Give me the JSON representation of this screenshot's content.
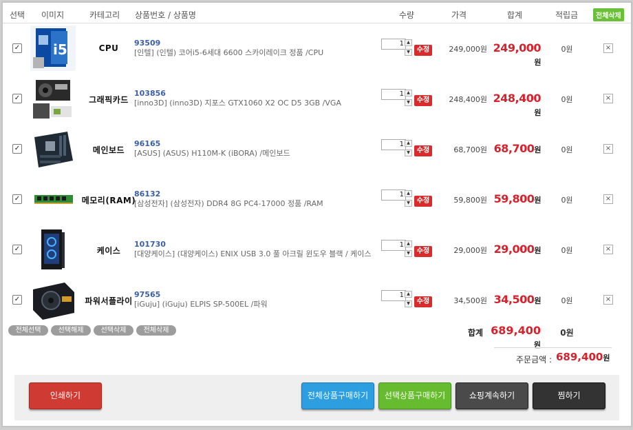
{
  "header": {
    "select": "선택",
    "image": "이미지",
    "category": "카테고리",
    "product": "상품번호 / 상품명",
    "qty": "수량",
    "price": "가격",
    "total": "합계",
    "points": "적립금",
    "delete_all": "전체삭제"
  },
  "items": [
    {
      "category": "CPU",
      "code": "93509",
      "name": "[인텔] (인텔) 코어i5-6세대 6600 스카이레이크 정품 /CPU",
      "qty": "1",
      "edit": "수정",
      "price": "249,000원",
      "total": "249,000",
      "won": "원",
      "points": "0원",
      "x": "×"
    },
    {
      "category": "그래픽카드",
      "code": "103856",
      "name": "[inno3D] (inno3D) 지포스 GTX1060 X2 OC D5 3GB /VGA",
      "qty": "1",
      "edit": "수정",
      "price": "248,400원",
      "total": "248,400",
      "won": "원",
      "points": "0원",
      "x": "×"
    },
    {
      "category": "메인보드",
      "code": "96165",
      "name": "[ASUS] (ASUS) H110M-K (iBORA) /메인보드",
      "qty": "1",
      "edit": "수정",
      "price": "68,700원",
      "total": "68,700",
      "won": "원",
      "points": "0원",
      "x": "×"
    },
    {
      "category": "메모리(RAM)",
      "code": "86132",
      "name": "[삼성전자] (삼성전자) DDR4 8G PC4-17000 정품 /RAM",
      "qty": "1",
      "edit": "수정",
      "price": "59,800원",
      "total": "59,800",
      "won": "원",
      "points": "0원",
      "x": "×"
    },
    {
      "category": "케이스",
      "code": "101730",
      "name": "[대양케이스] (대양케이스) ENIX USB 3.0 풀 아크릴 윈도우 블랙 / 케이스",
      "qty": "1",
      "edit": "수정",
      "price": "29,000원",
      "total": "29,000",
      "won": "원",
      "points": "0원",
      "x": "×"
    },
    {
      "category": "파워서플라이",
      "code": "97565",
      "name": "[iGuju] (iGuju) ELPIS SP-500EL /파워",
      "qty": "1",
      "edit": "수정",
      "price": "34,500원",
      "total": "34,500",
      "won": "원",
      "points": "0원",
      "x": "×"
    }
  ],
  "controls": {
    "select_all": "전체선택",
    "deselect": "선택해제",
    "delete_selected": "선택삭제",
    "delete_all": "전체삭제"
  },
  "summary": {
    "label": "합계",
    "total": "689,400",
    "won": "원",
    "points": "0원",
    "order_label": "주문금액 :",
    "order_total": "689,400"
  },
  "buttons": {
    "print": "인쇄하기",
    "buy_all": "전체상품구매하기",
    "buy_selected": "선택상품구매하기",
    "continue": "쇼핑계속하기",
    "wishlist": "찜하기"
  },
  "colors": {
    "accent_red": "#d6222d",
    "code_blue": "#3a5fa6",
    "green": "#6bbf3a"
  }
}
